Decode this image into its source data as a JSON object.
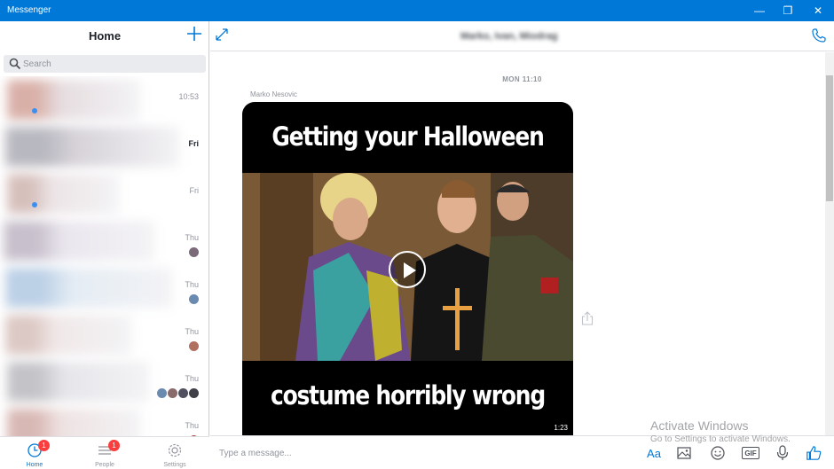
{
  "window": {
    "title": "Messenger",
    "minimize_glyph": "—",
    "restore_glyph": "❐",
    "close_glyph": "✕"
  },
  "sidebar": {
    "title": "Home",
    "compose_icon": "plus-icon",
    "search": {
      "placeholder": "Search"
    },
    "conversations": [
      {
        "time": "10:53",
        "bold": false,
        "blur_colors": [
          "#d9b0a8",
          "#e6dde0"
        ],
        "unread_dot": true,
        "avatars": []
      },
      {
        "time": "Fri",
        "bold": true,
        "blur_colors": [
          "#b8b8c0",
          "#d6d2d8"
        ],
        "unread_dot": false,
        "avatars": []
      },
      {
        "time": "Fri",
        "bold": false,
        "blur_colors": [
          "#d6c0bc",
          "#ece4e6"
        ],
        "unread_dot": true,
        "avatars": []
      },
      {
        "time": "Thu",
        "bold": false,
        "blur_colors": [
          "#c8c0cc",
          "#eae6ee"
        ],
        "unread_dot": false,
        "avatars": [
          "#7a6a7a"
        ]
      },
      {
        "time": "Thu",
        "bold": false,
        "blur_colors": [
          "#bcd0e6",
          "#e4ecf4"
        ],
        "unread_dot": false,
        "avatars": [
          "#6a8ab0"
        ]
      },
      {
        "time": "Thu",
        "bold": false,
        "blur_colors": [
          "#dcc8c4",
          "#f0e8e8"
        ],
        "unread_dot": false,
        "avatars": [
          "#b07060"
        ]
      },
      {
        "time": "Thu",
        "bold": false,
        "blur_colors": [
          "#c4c4c8",
          "#e6e6ea"
        ],
        "unread_dot": false,
        "avatars": [
          "#6a8ab0",
          "#8a6a6a",
          "#505060",
          "#404048"
        ]
      },
      {
        "time": "Thu",
        "bold": false,
        "blur_colors": [
          "#d8b8b4",
          "#eee2e2"
        ],
        "unread_dot": false,
        "avatars": [
          "#a04040"
        ]
      }
    ]
  },
  "bottom_nav": {
    "items": [
      {
        "label": "Home",
        "icon": "clock-icon",
        "badge": "1",
        "active": true
      },
      {
        "label": "People",
        "icon": "list-icon",
        "badge": "1",
        "active": false
      },
      {
        "label": "Settings",
        "icon": "gear-icon",
        "badge": "",
        "active": false
      }
    ]
  },
  "conversation": {
    "name": "Marko, Ivan, Miodrag",
    "date_separator": "MON 11:10",
    "sender": "Marko Nesovic",
    "video": {
      "caption_top": "Getting your Halloween",
      "caption_bottom": "costume horribly wrong",
      "duration": "1:23"
    },
    "composer": {
      "placeholder": "Type a message...",
      "text_tool": "Aa",
      "gif_label": "GIF"
    }
  },
  "watermark": {
    "line1": "Activate Windows",
    "line2": "Go to Settings to activate Windows."
  },
  "colors": {
    "accent": "#0078d7",
    "badge": "#fa3e3e",
    "like": "#0078d7"
  }
}
